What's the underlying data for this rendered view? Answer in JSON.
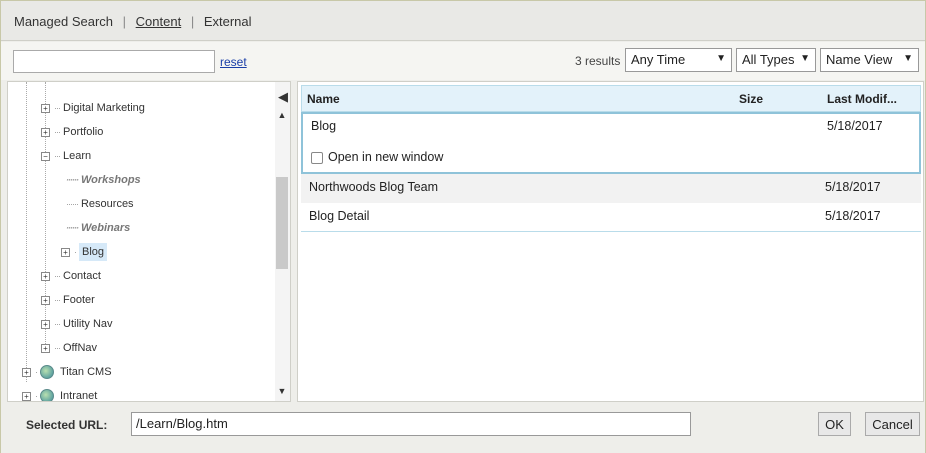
{
  "tabs": {
    "managed_search": "Managed Search",
    "content": "Content",
    "external": "External",
    "separator": "|"
  },
  "toolbar": {
    "search_value": "",
    "reset": "reset",
    "results_count": "3 results",
    "time_filter": "Any Time",
    "type_filter": "All Types",
    "view": "Name View"
  },
  "tree": {
    "items": [
      {
        "label": "Digital Marketing"
      },
      {
        "label": "Portfolio"
      },
      {
        "label": "Learn"
      },
      {
        "label": "Workshops"
      },
      {
        "label": "Resources"
      },
      {
        "label": "Webinars"
      },
      {
        "label": "Blog"
      },
      {
        "label": "Contact"
      },
      {
        "label": "Footer"
      },
      {
        "label": "Utility Nav"
      },
      {
        "label": "OffNav"
      },
      {
        "label": "Titan CMS"
      },
      {
        "label": "Intranet"
      }
    ]
  },
  "grid": {
    "columns": {
      "name": "Name",
      "size": "Size",
      "modified": "Last Modif..."
    },
    "rows": [
      {
        "name": "Blog",
        "modified": "5/18/2017",
        "open_new_window": "Open in new window"
      },
      {
        "name": "Northwoods Blog Team",
        "modified": "5/18/2017"
      },
      {
        "name": "Blog Detail",
        "modified": "5/18/2017"
      }
    ]
  },
  "footer": {
    "selected_url_label": "Selected URL:",
    "selected_url": "/Learn/Blog.htm",
    "ok": "OK",
    "cancel": "Cancel"
  }
}
